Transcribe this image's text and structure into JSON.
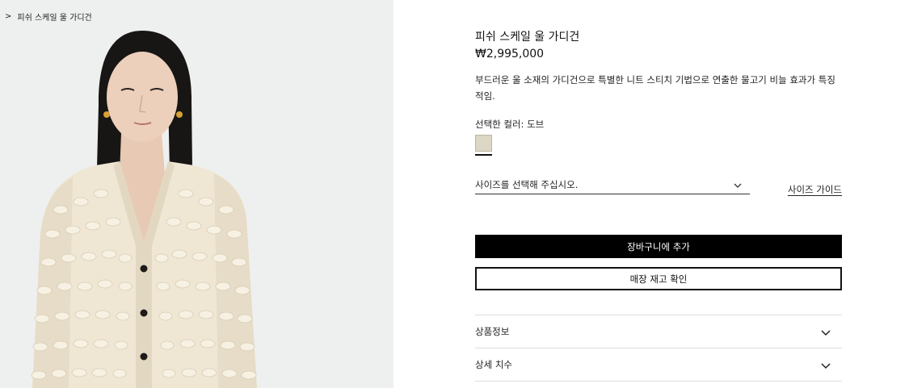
{
  "breadcrumb": {
    "chevron": ">",
    "label": "피쉬 스케일 울 가디건"
  },
  "product": {
    "title": "피쉬 스케일 울 가디건",
    "price": "₩2,995,000",
    "description": "부드러운 울 소재의 가디건으로 특별한 니트 스티치 기법으로 연출한 물고기 비늘 효과가 특징적임.",
    "color_label": "선택한 컬러: 도브",
    "swatch_color": "#dcd6c4"
  },
  "size": {
    "placeholder": "사이즈를 선택해 주십시오.",
    "guide_label": "사이즈 가이드"
  },
  "actions": {
    "add_to_cart": "장바구니에 추가",
    "check_stock": "매장 재고 확인"
  },
  "accordion": [
    {
      "label": "상품정보"
    },
    {
      "label": "상세 치수"
    }
  ],
  "icons": {
    "select": "chevron-down-icon",
    "accordion": "chevron-down-icon",
    "breadcrumb": "chevron-right-icon"
  },
  "colors": {
    "accent": "#000000",
    "image_bg": "#eef0f0",
    "cardigan": "#efe6d4"
  }
}
